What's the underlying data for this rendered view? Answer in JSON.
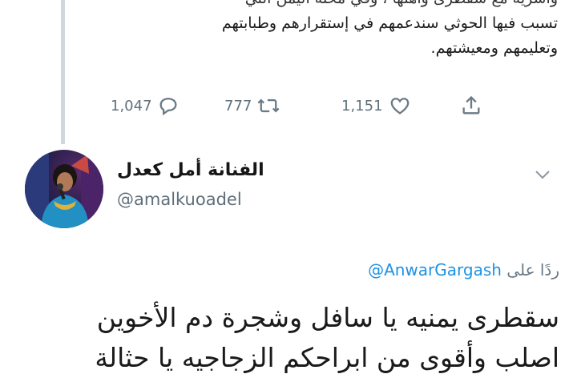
{
  "previous_tweet": {
    "text_lines": [
      "وأسرية مع سقطرى وأهلها ، وفي محنة اليمن التي",
      "تسبب فيها الحوثي سندعمهم في إستقرارهم وطبابتهم",
      "وتعليمهم ومعيشتهم."
    ],
    "reply_count": "1,047",
    "retweet_count": "777",
    "like_count": "1,151"
  },
  "author": {
    "display_name": "الفنانة أمل كعدل",
    "handle": "@amalkuoadel"
  },
  "reply_to": {
    "prefix": "ردًا على",
    "mention": "@AnwarGargash"
  },
  "tweet_lines": [
    "سقطرى يمنيه يا سافل وشجرة دم الأخوين",
    "اصلب وأقوى من ابراحكم الزجاجيه يا حثالة"
  ],
  "colors": {
    "accent": "#1d92e4",
    "muted": "#6b7b87"
  }
}
